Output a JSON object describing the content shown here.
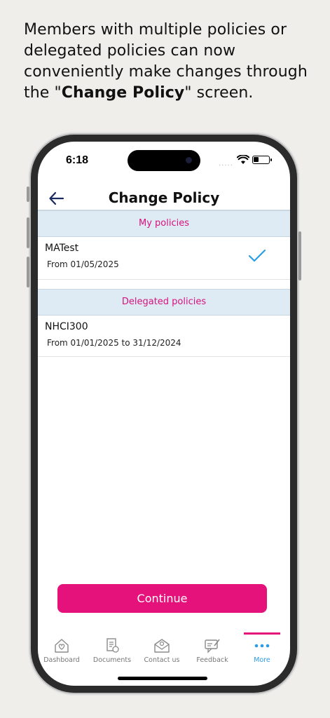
{
  "promo": {
    "line_before": "Members with multiple policies or delegated policies can now conveniently make changes through the \"",
    "bold": "Change Policy",
    "line_after": "\" screen."
  },
  "status_bar": {
    "time": "6:18",
    "signal": "....."
  },
  "header": {
    "title": "Change Policy",
    "back_icon": "arrow-left-icon"
  },
  "sections": {
    "my_policies": "My policies",
    "delegated": "Delegated policies"
  },
  "policies": {
    "mine": [
      {
        "name": "MATest",
        "range": "From 01/05/2025",
        "selected": true
      }
    ],
    "delegated": [
      {
        "name": "NHCI300",
        "range": "From 01/01/2025 to 31/12/2024",
        "selected": false
      }
    ]
  },
  "continue_label": "Continue",
  "tabs": [
    {
      "label": "Dashboard",
      "icon": "home-heart-icon"
    },
    {
      "label": "Documents",
      "icon": "documents-icon"
    },
    {
      "label": "Contact us",
      "icon": "mail-contact-icon"
    },
    {
      "label": "Feedback",
      "icon": "feedback-icon"
    },
    {
      "label": "More",
      "icon": "more-dots-icon",
      "active": true
    }
  ],
  "colors": {
    "accent": "#e6127c",
    "section_bg": "#deebf4",
    "active_tab": "#2c9ce3",
    "check": "#2c9ce3"
  }
}
